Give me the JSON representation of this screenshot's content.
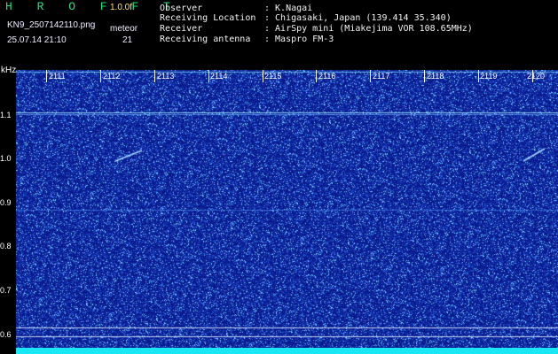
{
  "app": {
    "title": "H R O F F T",
    "version": "1.0.0f"
  },
  "file": {
    "name": "KN9_2507142110.png",
    "datetime": "25.07.14 21:10",
    "mode": "meteor",
    "count": "21"
  },
  "station_info": [
    {
      "label": "Observer",
      "value": ": K.Nagai"
    },
    {
      "label": "Receiving Location",
      "value": ": Chigasaki, Japan (139.414 35.340)"
    },
    {
      "label": "Receiver",
      "value": ": AirSpy mini (Miakejima VOR 108.65MHz)"
    },
    {
      "label": "Receiving antenna",
      "value": ": Maspro FM-3"
    }
  ],
  "axis": {
    "y_unit": "kHz",
    "y_ticks": [
      "1.1",
      "1.0",
      "0.9",
      "0.8",
      "0.7",
      "0.6"
    ],
    "x_ticks": [
      "2111",
      "2112",
      "2113",
      "2114",
      "2115",
      "2116",
      "2117",
      "2118",
      "2119",
      "2120"
    ]
  },
  "colors": {
    "background": "#0a1a8c",
    "noise_light": "#7fd6ff",
    "noise_mid": "#2a64e0",
    "band": "#19e8f4",
    "title_green": "#2fe07a",
    "version_yellow": "#ffe26a"
  }
}
